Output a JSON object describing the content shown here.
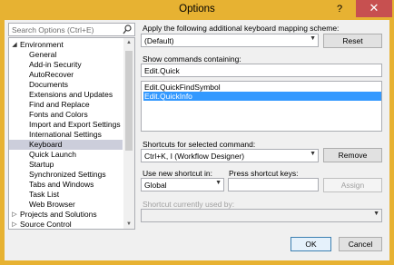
{
  "window": {
    "title": "Options",
    "help": "?",
    "close": "✕"
  },
  "search": {
    "placeholder": "Search Options (Ctrl+E)"
  },
  "tree": [
    {
      "label": "Environment",
      "expander": "◢",
      "indent": 0
    },
    {
      "label": "General",
      "indent": 1
    },
    {
      "label": "Add-in Security",
      "indent": 1
    },
    {
      "label": "AutoRecover",
      "indent": 1
    },
    {
      "label": "Documents",
      "indent": 1
    },
    {
      "label": "Extensions and Updates",
      "indent": 1
    },
    {
      "label": "Find and Replace",
      "indent": 1
    },
    {
      "label": "Fonts and Colors",
      "indent": 1
    },
    {
      "label": "Import and Export Settings",
      "indent": 1
    },
    {
      "label": "International Settings",
      "indent": 1
    },
    {
      "label": "Keyboard",
      "indent": 1,
      "selected": true
    },
    {
      "label": "Quick Launch",
      "indent": 1
    },
    {
      "label": "Startup",
      "indent": 1
    },
    {
      "label": "Synchronized Settings",
      "indent": 1
    },
    {
      "label": "Tabs and Windows",
      "indent": 1
    },
    {
      "label": "Task List",
      "indent": 1
    },
    {
      "label": "Web Browser",
      "indent": 1
    },
    {
      "label": "Projects and Solutions",
      "expander": "▷",
      "indent": 0
    },
    {
      "label": "Source Control",
      "expander": "▷",
      "indent": 0
    }
  ],
  "mapping": {
    "label": "Apply the following additional keyboard mapping scheme:",
    "value": "(Default)",
    "reset": "Reset"
  },
  "commands": {
    "label": "Show commands containing:",
    "filter": "Edit.Quick",
    "items": [
      "Edit.QuickFindSymbol",
      "Edit.QuickInfo"
    ],
    "selected_index": 1
  },
  "shortcuts": {
    "label": "Shortcuts for selected command:",
    "value": "Ctrl+K, I (Workflow Designer)",
    "remove": "Remove"
  },
  "new_shortcut": {
    "use_label": "Use new shortcut in:",
    "use_value": "Global",
    "press_label": "Press shortcut keys:",
    "press_value": "",
    "assign": "Assign"
  },
  "used_by": {
    "label": "Shortcut currently used by:",
    "value": ""
  },
  "footer": {
    "ok": "OK",
    "cancel": "Cancel"
  },
  "colors": {
    "title_bar": "#E7B232",
    "close": "#C75050",
    "selection": "#3399FF",
    "tree_selection": "#CCCEDB"
  }
}
